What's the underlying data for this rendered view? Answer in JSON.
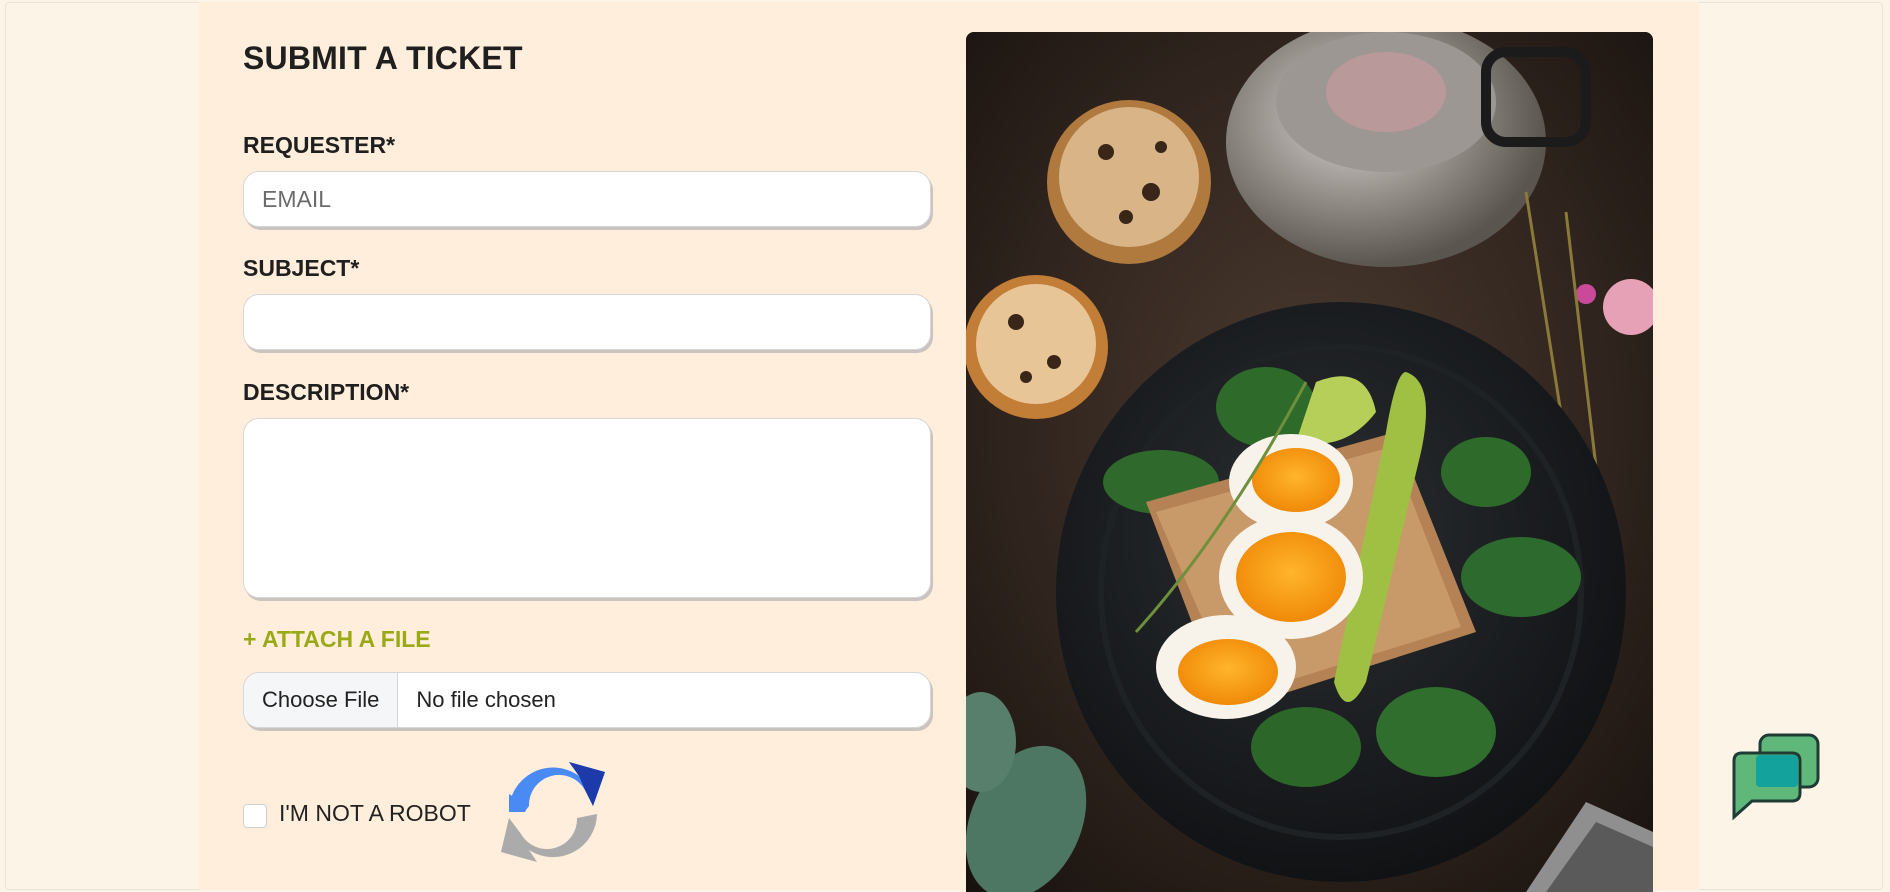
{
  "form": {
    "title": "SUBMIT A TICKET",
    "requester_label": "REQUESTER*",
    "requester_placeholder": "EMAIL",
    "requester_value": "",
    "subject_label": "SUBJECT*",
    "subject_value": "",
    "description_label": "DESCRIPTION*",
    "description_value": "",
    "attach_label": "+ ATTACH A FILE",
    "file_button": "Choose File",
    "file_status": "No file chosen"
  },
  "captcha": {
    "label": "I'M NOT A ROBOT",
    "icon": "recaptcha-logo-icon",
    "checked": false
  },
  "image": {
    "subject": "food-photo"
  },
  "chat": {
    "icon": "chat-bubbles-icon"
  },
  "colors": {
    "page_background": "#fdf4e8",
    "content_background": "#ffeedb",
    "accent": "#9aaa16",
    "chat_green": "#5fb87a",
    "chat_teal": "#14a39c"
  }
}
